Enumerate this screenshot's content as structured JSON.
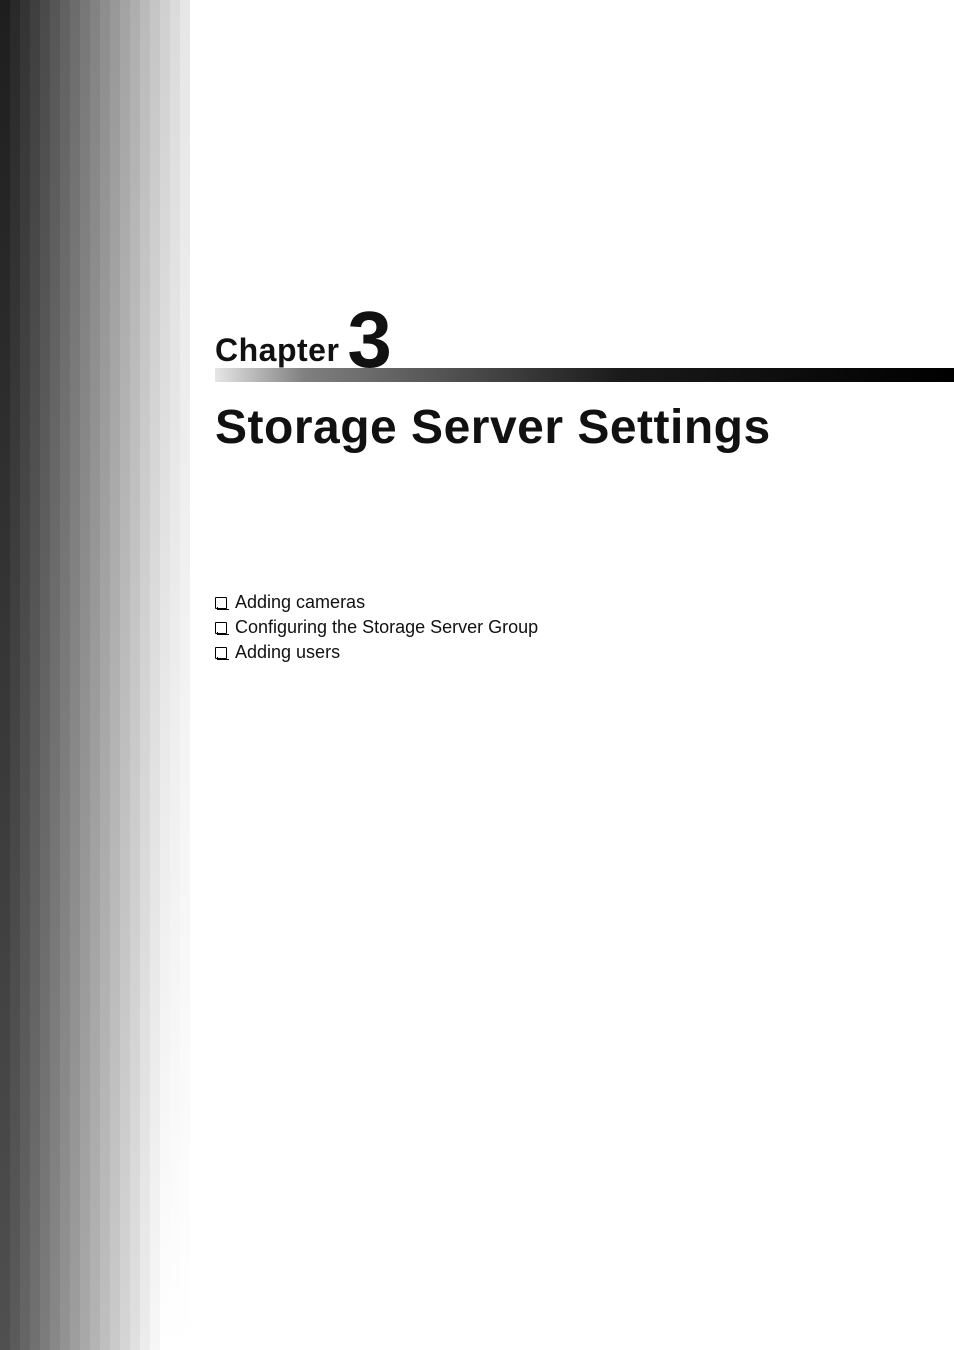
{
  "chapter": {
    "label": "Chapter",
    "number": "3",
    "title": "Storage Server Settings"
  },
  "toc": {
    "items": [
      {
        "text": "Adding cameras"
      },
      {
        "text": "Configuring the Storage Server Group"
      },
      {
        "text": "Adding users"
      }
    ]
  },
  "decor": {
    "bar_count": 19
  }
}
